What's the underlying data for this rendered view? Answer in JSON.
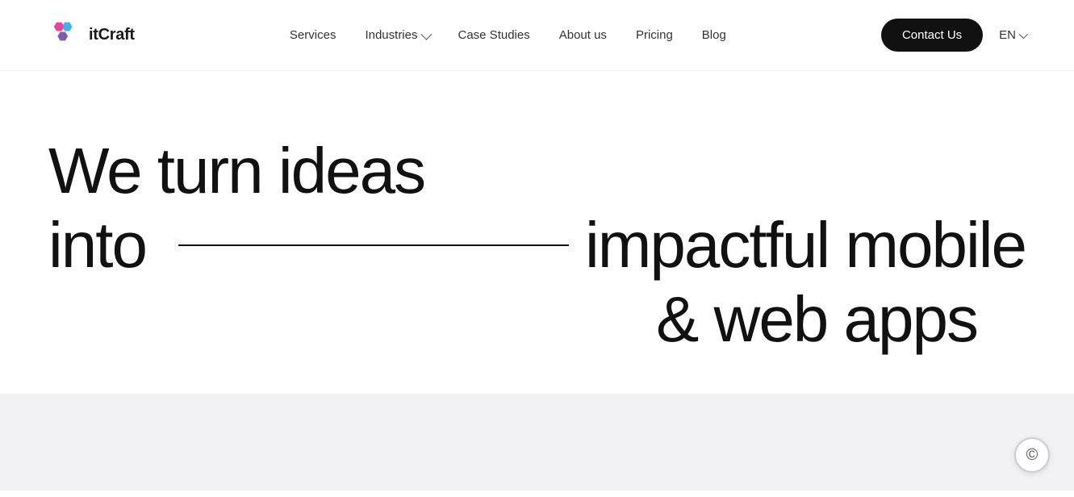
{
  "brand": {
    "name": "itCraft",
    "logo_alt": "itCraft logo"
  },
  "nav": {
    "links": [
      {
        "label": "Services",
        "has_dropdown": false
      },
      {
        "label": "Industries",
        "has_dropdown": true
      },
      {
        "label": "Case Studies",
        "has_dropdown": false
      },
      {
        "label": "About us",
        "has_dropdown": false
      },
      {
        "label": "Pricing",
        "has_dropdown": false
      },
      {
        "label": "Blog",
        "has_dropdown": false
      }
    ],
    "contact_button": "Contact Us",
    "language": "EN"
  },
  "hero": {
    "line1": "We turn ideas",
    "line2_start": "into",
    "line2_end": "impactful mobile",
    "line3": "& web apps"
  },
  "copyright": "©"
}
